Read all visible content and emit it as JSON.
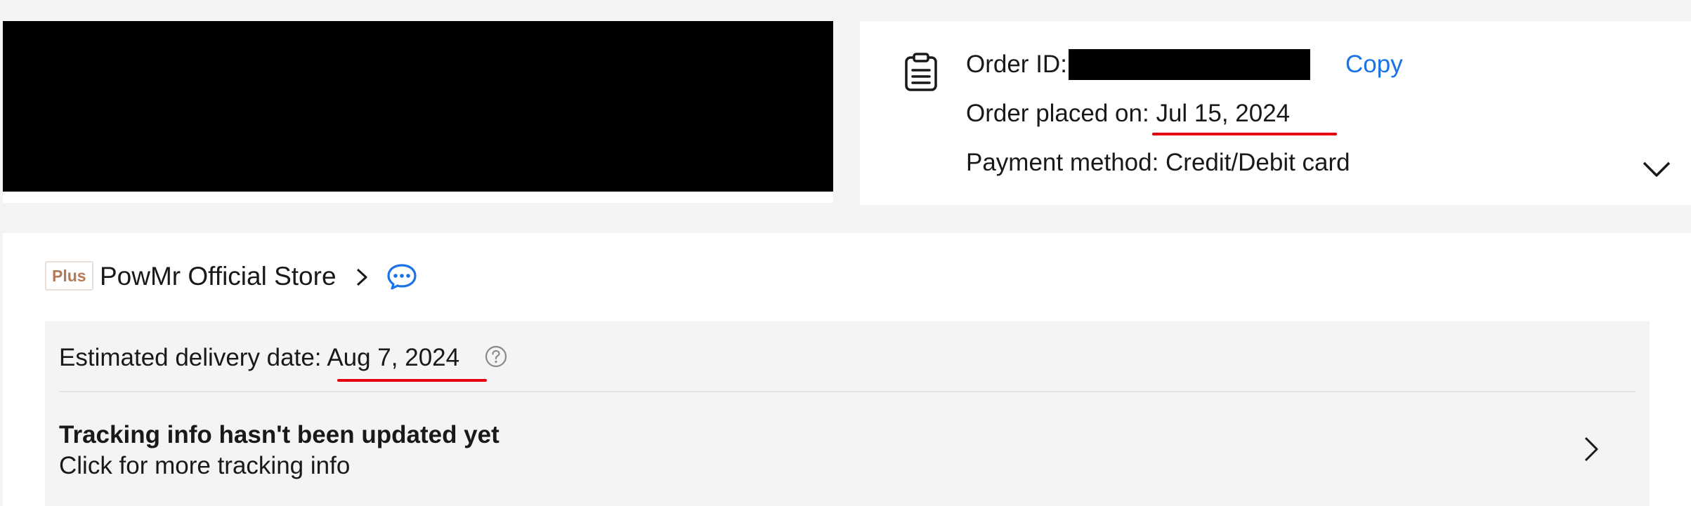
{
  "order": {
    "id_label": "Order ID:",
    "copy_label": "Copy",
    "placed_prefix": "Order placed on: ",
    "placed_date": "Jul 15, 2024",
    "payment_text": "Payment method: Credit/Debit card"
  },
  "store": {
    "badge": "Plus",
    "name": "PowMr Official Store"
  },
  "delivery": {
    "estimated_prefix": "Estimated delivery date: ",
    "estimated_date": "Aug 7, 2024",
    "tracking_title": "Tracking info hasn't been updated yet",
    "tracking_subtitle": "Click for more tracking info"
  },
  "colors": {
    "link_blue": "#1a73e8",
    "highlight_red": "#e4000f",
    "plus_badge": "#b47a55"
  },
  "icons": [
    "document-icon",
    "chevron-down-icon",
    "chevron-right-icon",
    "chat-icon",
    "help-icon"
  ]
}
